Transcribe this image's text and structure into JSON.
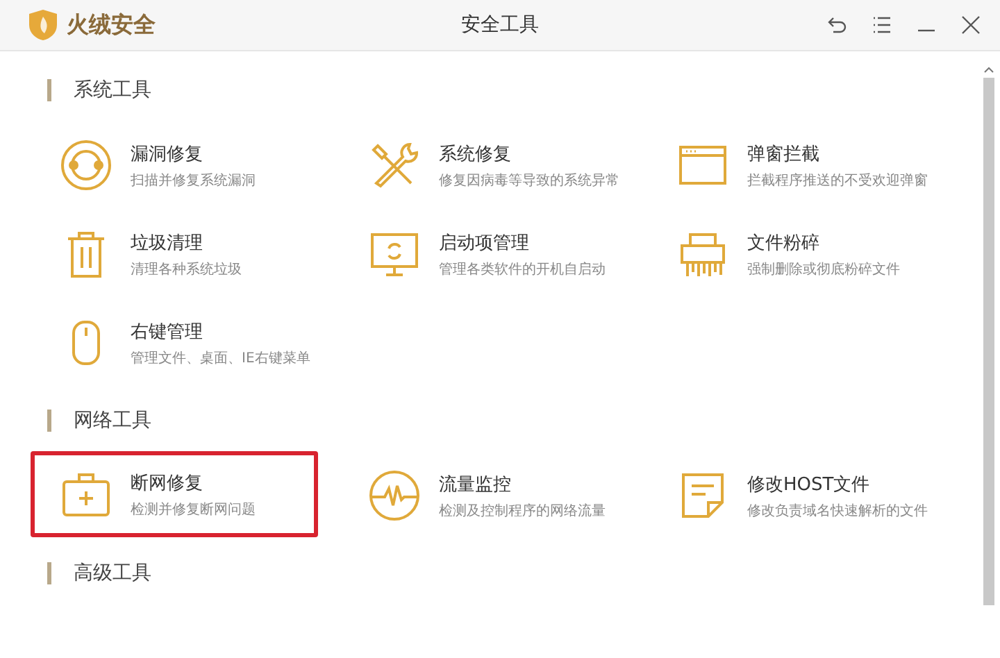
{
  "window": {
    "brand": "火绒安全",
    "title": "安全工具"
  },
  "sections": [
    {
      "title": "系统工具",
      "items": [
        {
          "name": "漏洞修复",
          "desc": "扫描并修复系统漏洞",
          "highlighted": false
        },
        {
          "name": "系统修复",
          "desc": "修复因病毒等导致的系统异常",
          "highlighted": false
        },
        {
          "name": "弹窗拦截",
          "desc": "拦截程序推送的不受欢迎弹窗",
          "highlighted": false
        },
        {
          "name": "垃圾清理",
          "desc": "清理各种系统垃圾",
          "highlighted": false
        },
        {
          "name": "启动项管理",
          "desc": "管理各类软件的开机自启动",
          "highlighted": false
        },
        {
          "name": "文件粉碎",
          "desc": "强制删除或彻底粉碎文件",
          "highlighted": false
        },
        {
          "name": "右键管理",
          "desc": "管理文件、桌面、IE右键菜单",
          "highlighted": false
        }
      ]
    },
    {
      "title": "网络工具",
      "items": [
        {
          "name": "断网修复",
          "desc": "检测并修复断网问题",
          "highlighted": true
        },
        {
          "name": "流量监控",
          "desc": "检测及控制程序的网络流量",
          "highlighted": false
        },
        {
          "name": "修改HOST文件",
          "desc": "修改负责域名快速解析的文件",
          "highlighted": false
        }
      ]
    },
    {
      "title": "高级工具"
    }
  ]
}
